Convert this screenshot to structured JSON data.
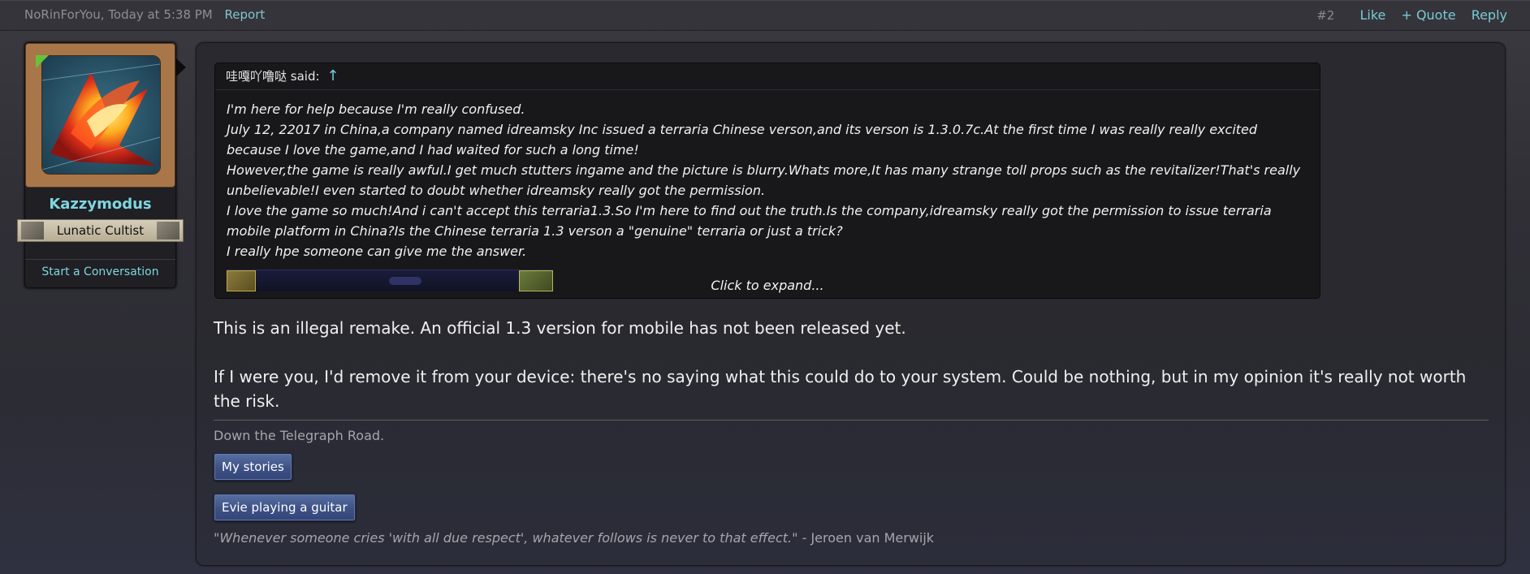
{
  "post_meta": {
    "author_time": "NoRinForYou, Today at 5:38 PM",
    "report_label": "Report",
    "post_number": "#2",
    "like_label": "Like",
    "quote_label": "+ Quote",
    "reply_label": "Reply"
  },
  "user": {
    "name": "Kazzymodus",
    "title": "Lunatic Cultist",
    "start_conversation": "Start a Conversation",
    "avatar_icon": "flame-bird-avatar"
  },
  "quote": {
    "author": "哇嘎吖噜哒",
    "said_label": "said:",
    "arrow": "↑",
    "lines": [
      "I'm here for help because I'm really confused.",
      "July 12, 22017 in China,a company named idreamsky Inc issued a terraria Chinese verson,and its verson is 1.3.0.7c.At the first time I was really really excited because I love the game,and I had waited for such a long time!",
      "However,the game is really awful.I get much stutters ingame and the picture is blurry.Whats more,It has many strange toll props such as the revitalizer!That's really unbelievable!I even started to doubt whether idreamsky really got the permission.",
      "I love the game so much!And i can't accept this terraria1.3.So I'm here to find out the truth.Is the company,idreamsky really got the permission to issue terraria mobile platform in China?Is the Chinese terraria 1.3 verson a \"genuine\" terraria or just a trick?",
      "I really hpe someone can give me the answer."
    ],
    "expand_label": "Click to expand..."
  },
  "message": {
    "paragraph1": "This is an illegal remake. An official 1.3 version for mobile has not been released yet.",
    "paragraph2": "If I were you, I'd remove it from your device: there's no saying what this could do to your system. Could be nothing, but in my opinion it's really not worth the risk."
  },
  "signature": {
    "line": "Down the Telegraph Road.",
    "button1": "My stories",
    "button2": "Evie playing a guitar",
    "quote_text": "\"Whenever someone cries 'with all due respect', whatever follows is never to that effect.\"",
    "quote_attribution": " - Jeroen van Merwijk"
  },
  "colors": {
    "link": "#78cad6",
    "username": "#7fd6df",
    "button": "#3d5184"
  }
}
